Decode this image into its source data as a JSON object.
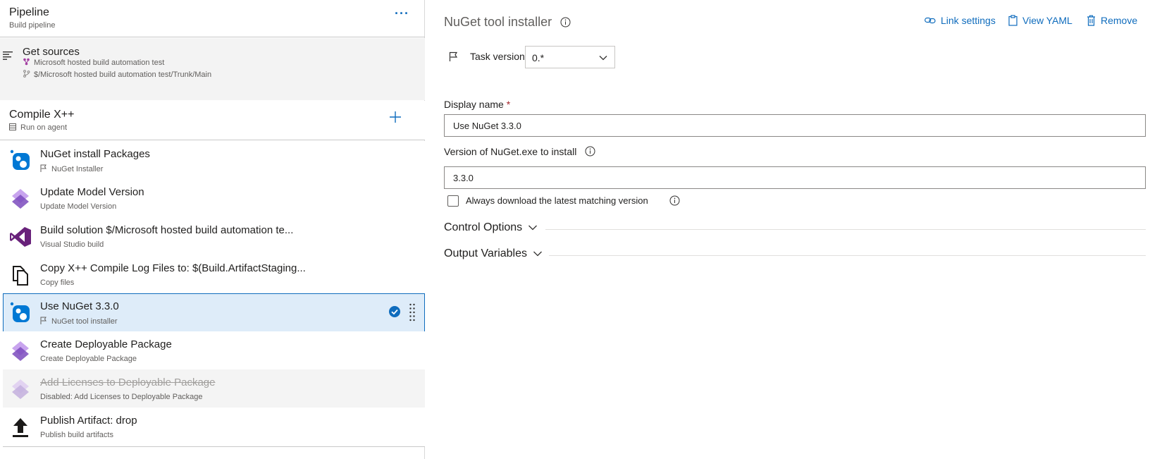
{
  "pipeline": {
    "title": "Pipeline",
    "subtitle": "Build pipeline",
    "more_label": "···"
  },
  "get_sources": {
    "title": "Get sources",
    "repo": "Microsoft hosted build automation test",
    "path": "$/Microsoft hosted build automation test/Trunk/Main"
  },
  "phase": {
    "title": "Compile X++",
    "subtitle": "Run on agent"
  },
  "tasks": [
    {
      "title": "NuGet install Packages",
      "subtitle": "NuGet Installer",
      "icon": "nuget-icon",
      "state": "normal"
    },
    {
      "title": "Update Model Version",
      "subtitle": "Update Model Version",
      "icon": "dynamics-icon",
      "state": "normal"
    },
    {
      "title": "Build solution $/Microsoft hosted build automation te...",
      "subtitle": "Visual Studio build",
      "icon": "visual-studio-icon",
      "state": "normal"
    },
    {
      "title": "Copy X++ Compile Log Files to: $(Build.ArtifactStaging...",
      "subtitle": "Copy files",
      "icon": "copy-files-icon",
      "state": "normal"
    },
    {
      "title": "Use NuGet 3.3.0",
      "subtitle": "NuGet tool installer",
      "icon": "nuget-icon",
      "state": "selected"
    },
    {
      "title": "Create Deployable Package",
      "subtitle": "Create Deployable Package",
      "icon": "dynamics-icon",
      "state": "normal"
    },
    {
      "title": "Add Licenses to Deployable Package",
      "subtitle": "Disabled: Add Licenses to Deployable Package",
      "icon": "dynamics-icon",
      "state": "disabled"
    },
    {
      "title": "Publish Artifact: drop",
      "subtitle": "Publish build artifacts",
      "icon": "upload-icon",
      "state": "normal"
    }
  ],
  "detail": {
    "title": "NuGet tool installer",
    "actions": {
      "link_settings": "Link settings",
      "view_yaml": "View YAML",
      "remove": "Remove"
    },
    "task_version": {
      "label": "Task version",
      "value": "0.*"
    },
    "display_name": {
      "label": "Display name",
      "required": "*",
      "value": "Use NuGet 3.3.0"
    },
    "version_spec": {
      "label": "Version of NuGet.exe to install",
      "value": "3.3.0"
    },
    "checkbox": {
      "label": "Always download the latest matching version",
      "checked": false
    },
    "sections": {
      "control_options": "Control Options",
      "output_variables": "Output Variables"
    }
  },
  "colors": {
    "accent": "#0f6cbd",
    "selected_bg": "#deecf9",
    "dynamics_purple": "#8661c5",
    "vs_purple": "#68217a"
  }
}
